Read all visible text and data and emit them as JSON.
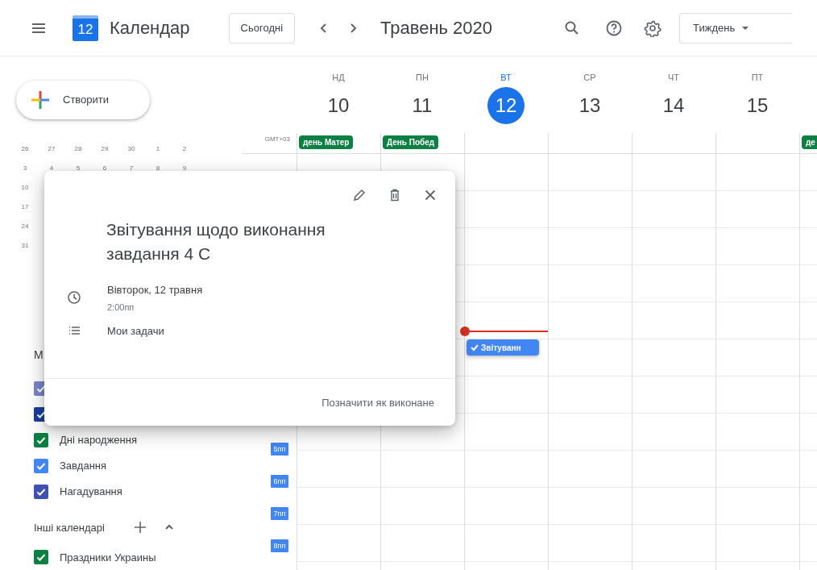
{
  "header": {
    "logo_day": "12",
    "app_name": "Календар",
    "today_button": "Сьогодні",
    "month_title": "Травень 2020",
    "view_dropdown": "Тиждень"
  },
  "create_button": "Створити",
  "mini_calendar": {
    "rows": [
      [
        "26",
        "27",
        "28",
        "29",
        "30",
        "1",
        "2"
      ],
      [
        "3",
        "4",
        "5",
        "6",
        "7",
        "8",
        "9"
      ],
      [
        "10"
      ],
      [
        "17"
      ],
      [
        "24"
      ],
      [
        "31"
      ]
    ]
  },
  "my_calendars": {
    "heading": "М",
    "items": [
      {
        "color": "#7986cb",
        "checked": true
      },
      {
        "color": "#1a3e9c",
        "checked": true
      },
      {
        "label": "Дні народження",
        "color": "#0b8043",
        "checked": true
      },
      {
        "label": "Завдання",
        "color": "#4285f4",
        "checked": true
      },
      {
        "label": "Нагадування",
        "color": "#3f51b5",
        "checked": true
      }
    ]
  },
  "other_calendars": {
    "heading": "Інші календарі",
    "items": [
      {
        "label": "Праздники Украины",
        "color": "#0b8043",
        "checked": true
      }
    ]
  },
  "timezone": "GMT+03",
  "hour_labels": [
    "5пп",
    "6пп",
    "7пп",
    "8пп"
  ],
  "days": [
    {
      "weekday": "НД",
      "date": "10",
      "selected": false,
      "all_day": [
        {
          "title": "день Матер",
          "color": "#0b8043"
        }
      ]
    },
    {
      "weekday": "ПН",
      "date": "11",
      "selected": false,
      "all_day": [
        {
          "title": "День Побед",
          "color": "#0b8043"
        }
      ]
    },
    {
      "weekday": "ВТ",
      "date": "12",
      "selected": true,
      "now_indicator": true,
      "events": [
        {
          "title": "Звітуванн",
          "done": true
        }
      ]
    },
    {
      "weekday": "СР",
      "date": "13",
      "selected": false
    },
    {
      "weekday": "ЧТ",
      "date": "14",
      "selected": false
    },
    {
      "weekday": "ПТ",
      "date": "15",
      "selected": false
    },
    {
      "all_day": [
        {
          "title": "де",
          "color": "#0b8043"
        }
      ]
    }
  ],
  "popup": {
    "title": "Звітування щодо виконання завдання 4 С",
    "date_text": "Вівторок, 12 травня",
    "time_text": "2:00пп",
    "calendar_name": "Мои задачи",
    "action_button": "Позначити як виконане"
  }
}
